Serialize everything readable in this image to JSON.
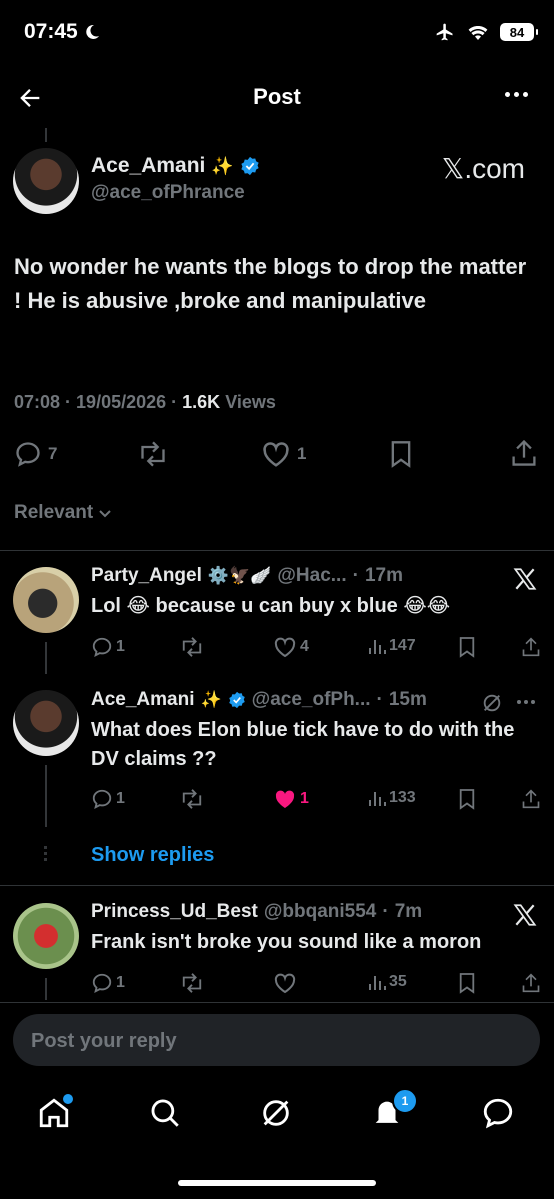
{
  "status": {
    "time": "07:45",
    "battery": "84"
  },
  "header": {
    "title": "Post"
  },
  "post": {
    "author_name": "Ace_Amani",
    "author_emoji": "✨",
    "author_handle": "@ace_ofPhrance",
    "source_watermark": "𝕏.com",
    "text": "No wonder he wants the blogs to drop the matter ! He is abusive ,broke and manipulative",
    "time": "07:08",
    "date": "19/05/2026",
    "views_count": "1.6K",
    "views_label": "Views",
    "replies": "7",
    "likes": "1"
  },
  "sort": {
    "label": "Relevant"
  },
  "replies": [
    {
      "name": "Party_Angel",
      "name_emojis": "⚙️🦅🪽",
      "handle": "@Hac...",
      "age": "17m",
      "text": "Lol 😂 because u can buy x blue 😂😂",
      "replies": "1",
      "retweets": "",
      "likes": "4",
      "views": "147"
    },
    {
      "name": "Ace_Amani",
      "name_emojis": "✨",
      "handle": "@ace_ofPh...",
      "age": "15m",
      "text": "What does Elon blue tick have to do with the DV claims ??",
      "replies": "1",
      "retweets": "",
      "likes": "1",
      "views": "133"
    },
    {
      "name": "Princess_Ud_Best",
      "name_emojis": "",
      "handle": "@bbqani554",
      "age": "7m",
      "text": "Frank isn't broke you sound like a moron",
      "replies": "1",
      "retweets": "",
      "likes": "",
      "views": "35"
    }
  ],
  "show_replies": "Show replies",
  "composer": {
    "placeholder": "Post your reply"
  },
  "nav": {
    "notifications_badge": "1"
  },
  "colors": {
    "accent": "#1d9bf0",
    "like_active": "#f91880",
    "muted": "#71767b",
    "background": "#000000"
  }
}
